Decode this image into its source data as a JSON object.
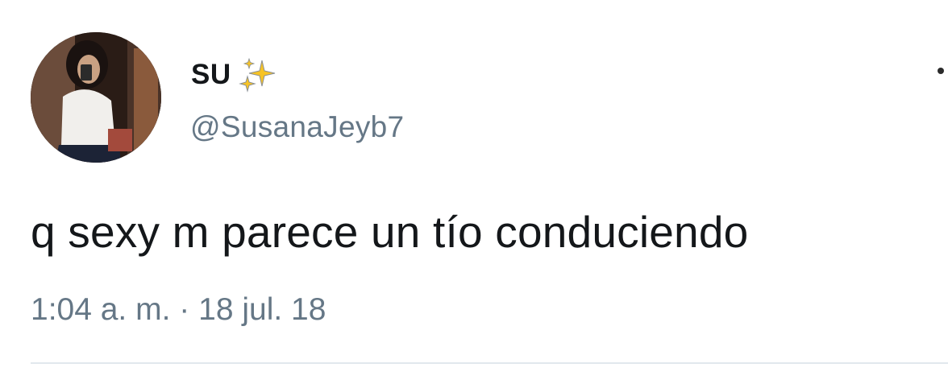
{
  "tweet": {
    "display_name": "SU",
    "display_name_emoji": "sparkles-icon",
    "handle": "@SusanaJeyb7",
    "text": "q sexy m parece un tío conduciendo",
    "time": "1:04 a. m.",
    "separator": "·",
    "date": "18 jul. 18"
  },
  "icons": {
    "menu": "more-dots-icon",
    "avatar": "profile-avatar"
  },
  "colors": {
    "name": "#14171a",
    "handle": "#657786",
    "text": "#14171a",
    "meta": "#657786",
    "sparkles": "#f7c325",
    "divider": "#e1e8ed"
  }
}
